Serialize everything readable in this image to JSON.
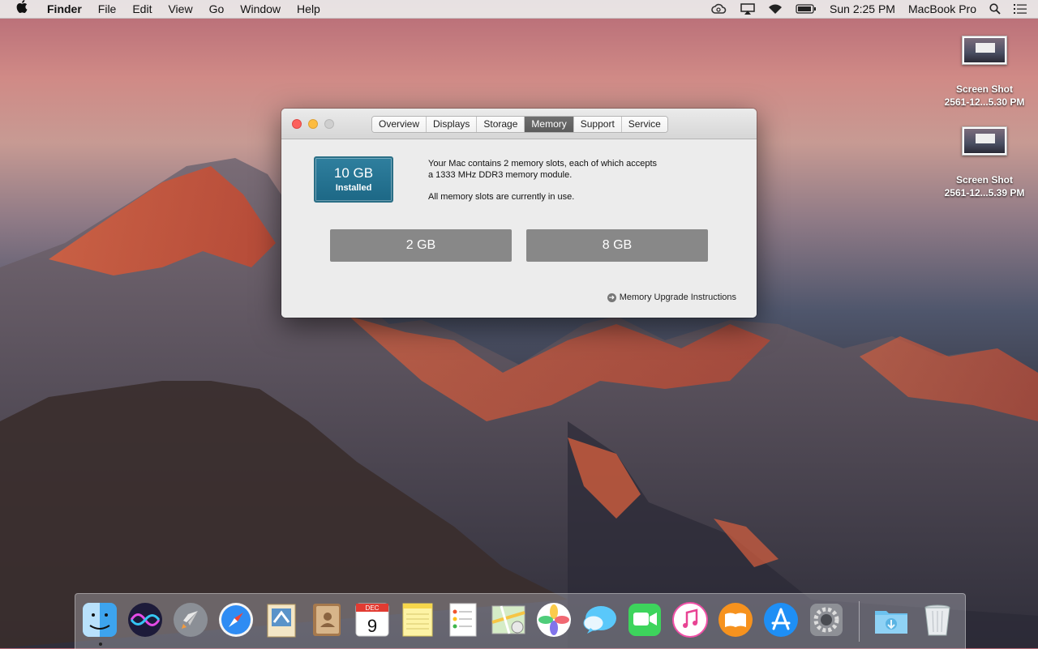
{
  "menubar": {
    "apple": "",
    "app_name": "Finder",
    "menus": [
      "File",
      "Edit",
      "View",
      "Go",
      "Window",
      "Help"
    ],
    "clock": "Sun 2:25 PM",
    "user": "MacBook Pro"
  },
  "desktop": {
    "icons": [
      {
        "line1": "Screen Shot",
        "line2": "2561-12...5.30 PM"
      },
      {
        "line1": "Screen Shot",
        "line2": "2561-12...5.39 PM"
      }
    ]
  },
  "about_window": {
    "tabs": [
      "Overview",
      "Displays",
      "Storage",
      "Memory",
      "Support",
      "Service"
    ],
    "active_tab": "Memory",
    "installed_amount": "10 GB",
    "installed_label": "Installed",
    "description_line1": "Your Mac contains 2 memory slots, each of which accepts",
    "description_line2": "a 1333 MHz DDR3 memory module.",
    "description_line3": "All memory slots are currently in use.",
    "slots": [
      "2 GB",
      "8 GB"
    ],
    "upgrade_link": "Memory Upgrade Instructions"
  },
  "dock": {
    "apps": [
      "finder-icon",
      "siri-icon",
      "launchpad-icon",
      "safari-icon",
      "mail-icon",
      "contacts-icon",
      "calendar-icon",
      "notes-icon",
      "reminders-icon",
      "maps-icon",
      "photos-icon",
      "messages-icon",
      "facetime-icon",
      "itunes-icon",
      "ibooks-icon",
      "app-store-icon",
      "system-preferences-icon",
      "downloads-folder-icon",
      "trash-icon"
    ],
    "calendar_month": "DEC",
    "calendar_day": "9"
  }
}
